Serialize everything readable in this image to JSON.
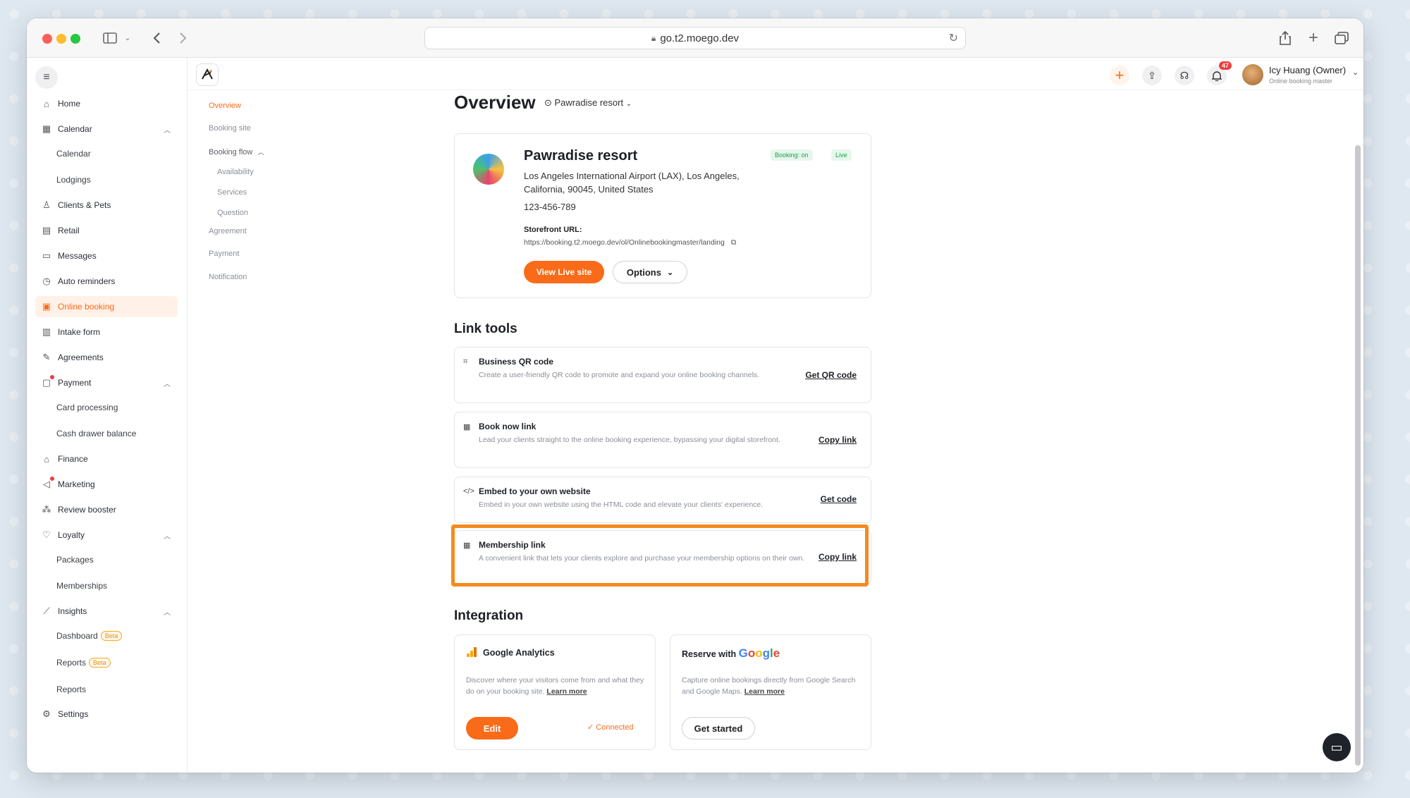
{
  "browser": {
    "url": "go.t2.moego.dev"
  },
  "sidebar": {
    "items": [
      {
        "label": "Home",
        "icon": "home-icon"
      },
      {
        "label": "Calendar",
        "icon": "calendar-icon"
      },
      {
        "label": "Calendar",
        "sub": true
      },
      {
        "label": "Lodgings",
        "sub": true
      },
      {
        "label": "Clients & Pets",
        "icon": "clients-icon"
      },
      {
        "label": "Retail",
        "icon": "retail-icon"
      },
      {
        "label": "Messages",
        "icon": "messages-icon"
      },
      {
        "label": "Auto reminders",
        "icon": "alarm-icon"
      },
      {
        "label": "Online booking",
        "icon": "online-booking-icon"
      },
      {
        "label": "Intake form",
        "icon": "form-icon"
      },
      {
        "label": "Agreements",
        "icon": "pen-icon"
      },
      {
        "label": "Payment",
        "icon": "payment-icon"
      },
      {
        "label": "Card processing",
        "sub": true
      },
      {
        "label": "Cash drawer balance",
        "sub": true
      },
      {
        "label": "Finance",
        "icon": "bank-icon"
      },
      {
        "label": "Marketing",
        "icon": "megaphone-icon"
      },
      {
        "label": "Review booster",
        "icon": "review-icon"
      },
      {
        "label": "Loyalty",
        "icon": "loyalty-icon"
      },
      {
        "label": "Packages",
        "sub": true
      },
      {
        "label": "Memberships",
        "sub": true
      },
      {
        "label": "Insights",
        "icon": "chart-icon"
      },
      {
        "label": "Dashboard",
        "sub": true,
        "badge": "Beta"
      },
      {
        "label": "Reports",
        "sub": true,
        "badge": "Beta"
      },
      {
        "label": "Reports",
        "sub": true
      },
      {
        "label": "Settings",
        "icon": "gear-icon"
      }
    ]
  },
  "appbar": {
    "notification_count": "47",
    "user_name": "Icy Huang (Owner)",
    "user_role": "Online booking master"
  },
  "subnav": {
    "items": [
      "Overview",
      "Booking site",
      "Booking flow",
      "Availability",
      "Services",
      "Question",
      "Agreement",
      "Payment",
      "Notification"
    ]
  },
  "overview": {
    "title": "Overview",
    "location": "Pawradise resort",
    "business": {
      "name": "Pawradise resort",
      "address": "Los Angeles International Airport (LAX), Los Angeles, California, 90045, United States",
      "phone": "123-456-789",
      "storefront_label": "Storefront URL:",
      "storefront_url": "https://booking.t2.moego.dev/ol/Onlinebookingmaster/landing",
      "booking_status": "Booking: on",
      "live_status": "Live",
      "view_live_label": "View Live site",
      "options_label": "Options"
    }
  },
  "link_tools": {
    "title": "Link tools",
    "items": [
      {
        "title": "Business QR code",
        "desc": "Create a user-friendly QR code to promote and expand your online booking channels.",
        "action": "Get QR code"
      },
      {
        "title": "Book now link",
        "desc": "Lead your clients straight to the online booking experience, bypassing your digital storefront.",
        "action": "Copy link"
      },
      {
        "title": "Embed to your own website",
        "desc": "Embed in your own website using the HTML code and elevate your clients' experience.",
        "action": "Get code"
      },
      {
        "title": "Membership link",
        "desc": "A convenient link that lets your clients explore and purchase your membership options on their own.",
        "action": "Copy link"
      }
    ]
  },
  "integration": {
    "title": "Integration",
    "ga": {
      "title": "Google Analytics",
      "desc": "Discover where your visitors come from and what they do on your booking site.",
      "learn_more": "Learn more",
      "edit_label": "Edit",
      "status": "Connected"
    },
    "reserve": {
      "title_prefix": "Reserve with",
      "brand": "Google",
      "desc": "Capture online bookings directly from Google Search and Google Maps.",
      "learn_more": "Learn more",
      "cta": "Get started"
    }
  },
  "colors": {
    "accent": "#f96b18",
    "highlight": "#f68a1e",
    "success": "#19a14d"
  }
}
